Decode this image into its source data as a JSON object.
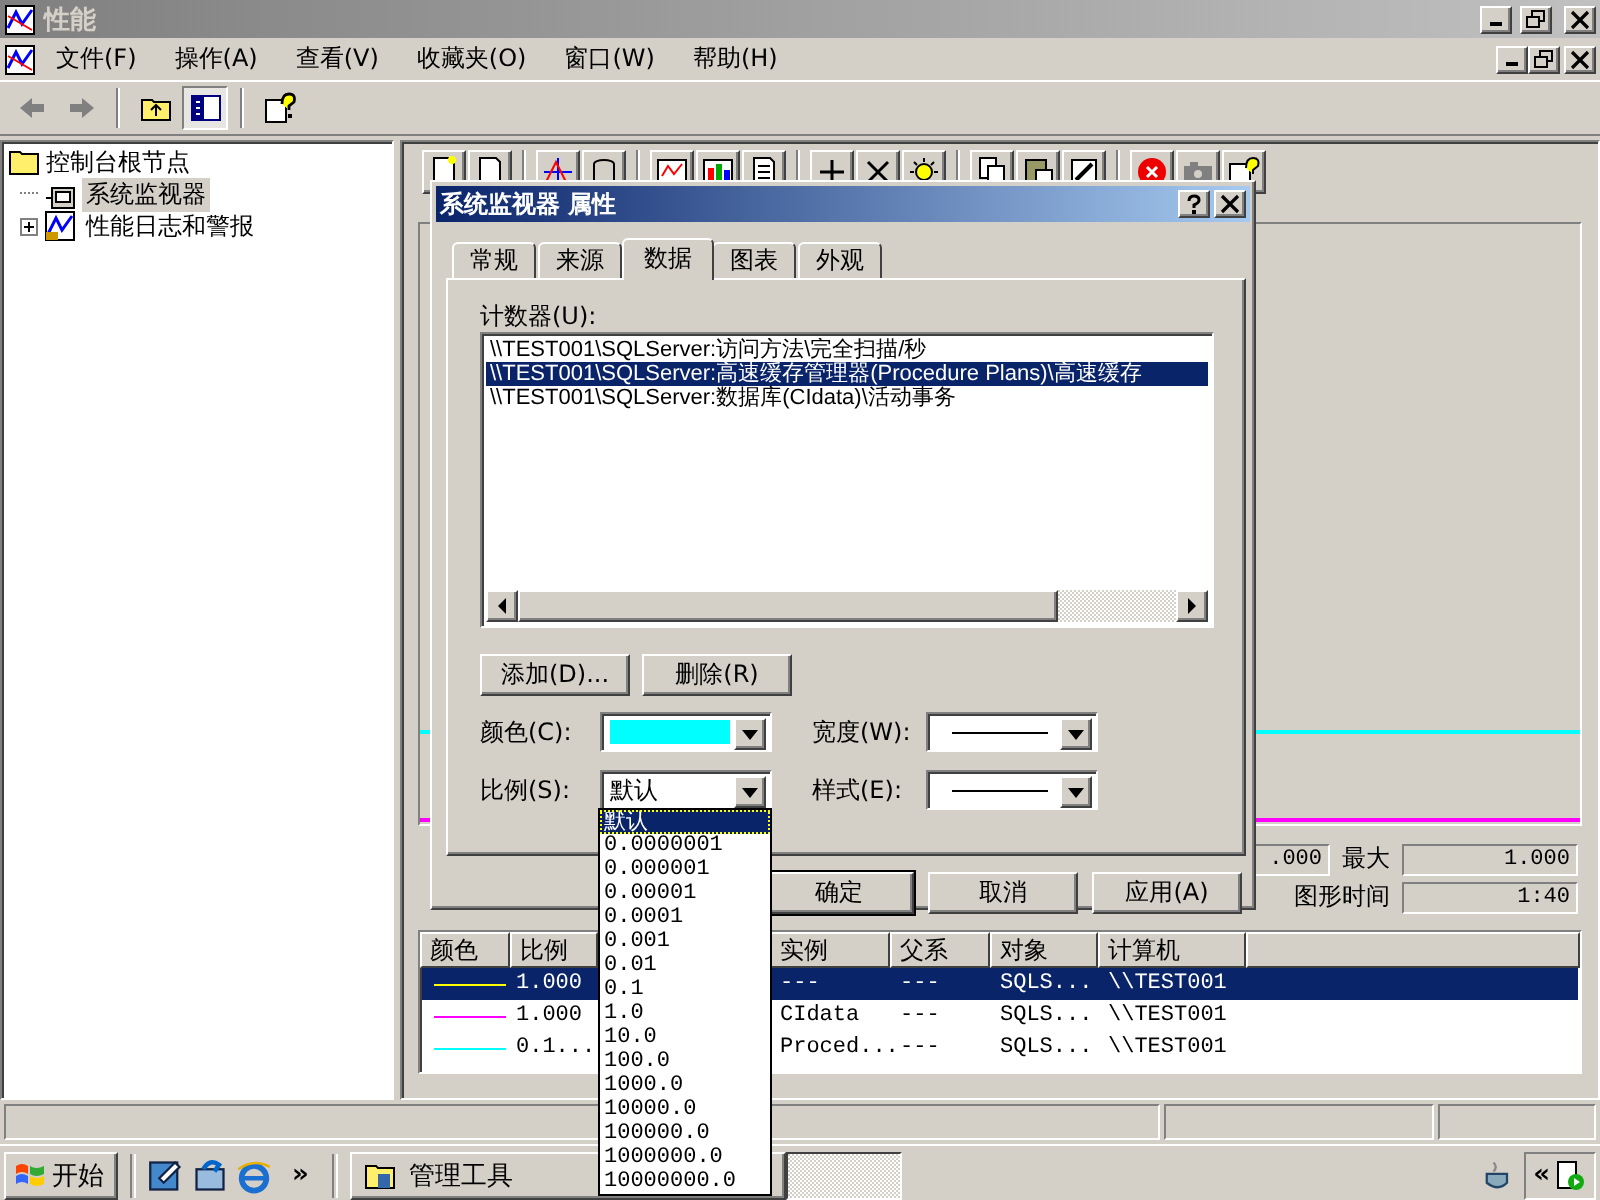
{
  "window": {
    "title": "性能"
  },
  "menu": [
    "文件(F)",
    "操作(A)",
    "查看(V)",
    "收藏夹(O)",
    "窗口(W)",
    "帮助(H)"
  ],
  "console_toolbar": {
    "tree_toggle_pressed": true
  },
  "tree": [
    {
      "label": "控制台根节点",
      "selected": false,
      "children": [
        {
          "label": "系统监视器",
          "selected": true
        },
        {
          "label": "性能日志和警报",
          "selected": false,
          "expanded": false
        }
      ]
    }
  ],
  "graph_stats": {
    "min_value": ".000",
    "max_label": "最大",
    "max_value": "1.000",
    "duration_label": "图形时间",
    "duration_value": "1:40"
  },
  "legend": {
    "columns": [
      "颜色",
      "比例",
      "实例",
      "父系",
      "对象",
      "计算机"
    ],
    "rows": [
      {
        "color": "#ffff00",
        "scale": "1.000",
        "instance": "---",
        "parent": "---",
        "object": "SQLS...",
        "computer": "\\\\TEST001",
        "selected": true
      },
      {
        "color": "#ff00ff",
        "scale": "1.000",
        "instance": "CIdata",
        "parent": "---",
        "object": "SQLS...",
        "computer": "\\\\TEST001",
        "selected": false
      },
      {
        "color": "#00ffff",
        "scale": "0.1...",
        "instance": "Proced...",
        "parent": "---",
        "object": "SQLS...",
        "computer": "\\\\TEST001",
        "selected": false
      }
    ]
  },
  "dialog": {
    "title": "系统监视器 属性",
    "tabs": [
      {
        "label": "常规",
        "selected": false
      },
      {
        "label": "来源",
        "selected": false
      },
      {
        "label": "数据",
        "selected": true
      },
      {
        "label": "图表",
        "selected": false
      },
      {
        "label": "外观",
        "selected": false
      }
    ],
    "counters_label": "计数器(U):",
    "counters": [
      {
        "text": "\\\\TEST001\\SQLServer:访问方法\\完全扫描/秒",
        "selected": false
      },
      {
        "text": "\\\\TEST001\\SQLServer:高速缓存管理器(Procedure Plans)\\高速缓存",
        "selected": true
      },
      {
        "text": "\\\\TEST001\\SQLServer:数据库(CIdata)\\活动事务",
        "selected": false
      }
    ],
    "add_button": "添加(D)...",
    "remove_button": "删除(R)",
    "color_label": "颜色(C):",
    "color": "#00ffff",
    "width_label": "宽度(W):",
    "scale_label": "比例(S):",
    "scale_value": "默认",
    "style_label": "样式(E):",
    "buttons": [
      "确定",
      "取消",
      "应用(A)"
    ],
    "scale_options": [
      {
        "label": "默认",
        "selected": true
      },
      {
        "label": "0.0000001",
        "selected": false
      },
      {
        "label": "0.000001",
        "selected": false
      },
      {
        "label": "0.00001",
        "selected": false
      },
      {
        "label": "0.0001",
        "selected": false
      },
      {
        "label": "0.001",
        "selected": false
      },
      {
        "label": "0.01",
        "selected": false
      },
      {
        "label": "0.1",
        "selected": false
      },
      {
        "label": "1.0",
        "selected": false
      },
      {
        "label": "10.0",
        "selected": false
      },
      {
        "label": "100.0",
        "selected": false
      },
      {
        "label": "1000.0",
        "selected": false
      },
      {
        "label": "10000.0",
        "selected": false
      },
      {
        "label": "100000.0",
        "selected": false
      },
      {
        "label": "1000000.0",
        "selected": false
      },
      {
        "label": "10000000.0",
        "selected": false
      }
    ]
  },
  "taskbar": {
    "start": "开始",
    "more": "»",
    "tasks": [
      {
        "label": "管理工具"
      }
    ],
    "tray_expand": "«"
  }
}
